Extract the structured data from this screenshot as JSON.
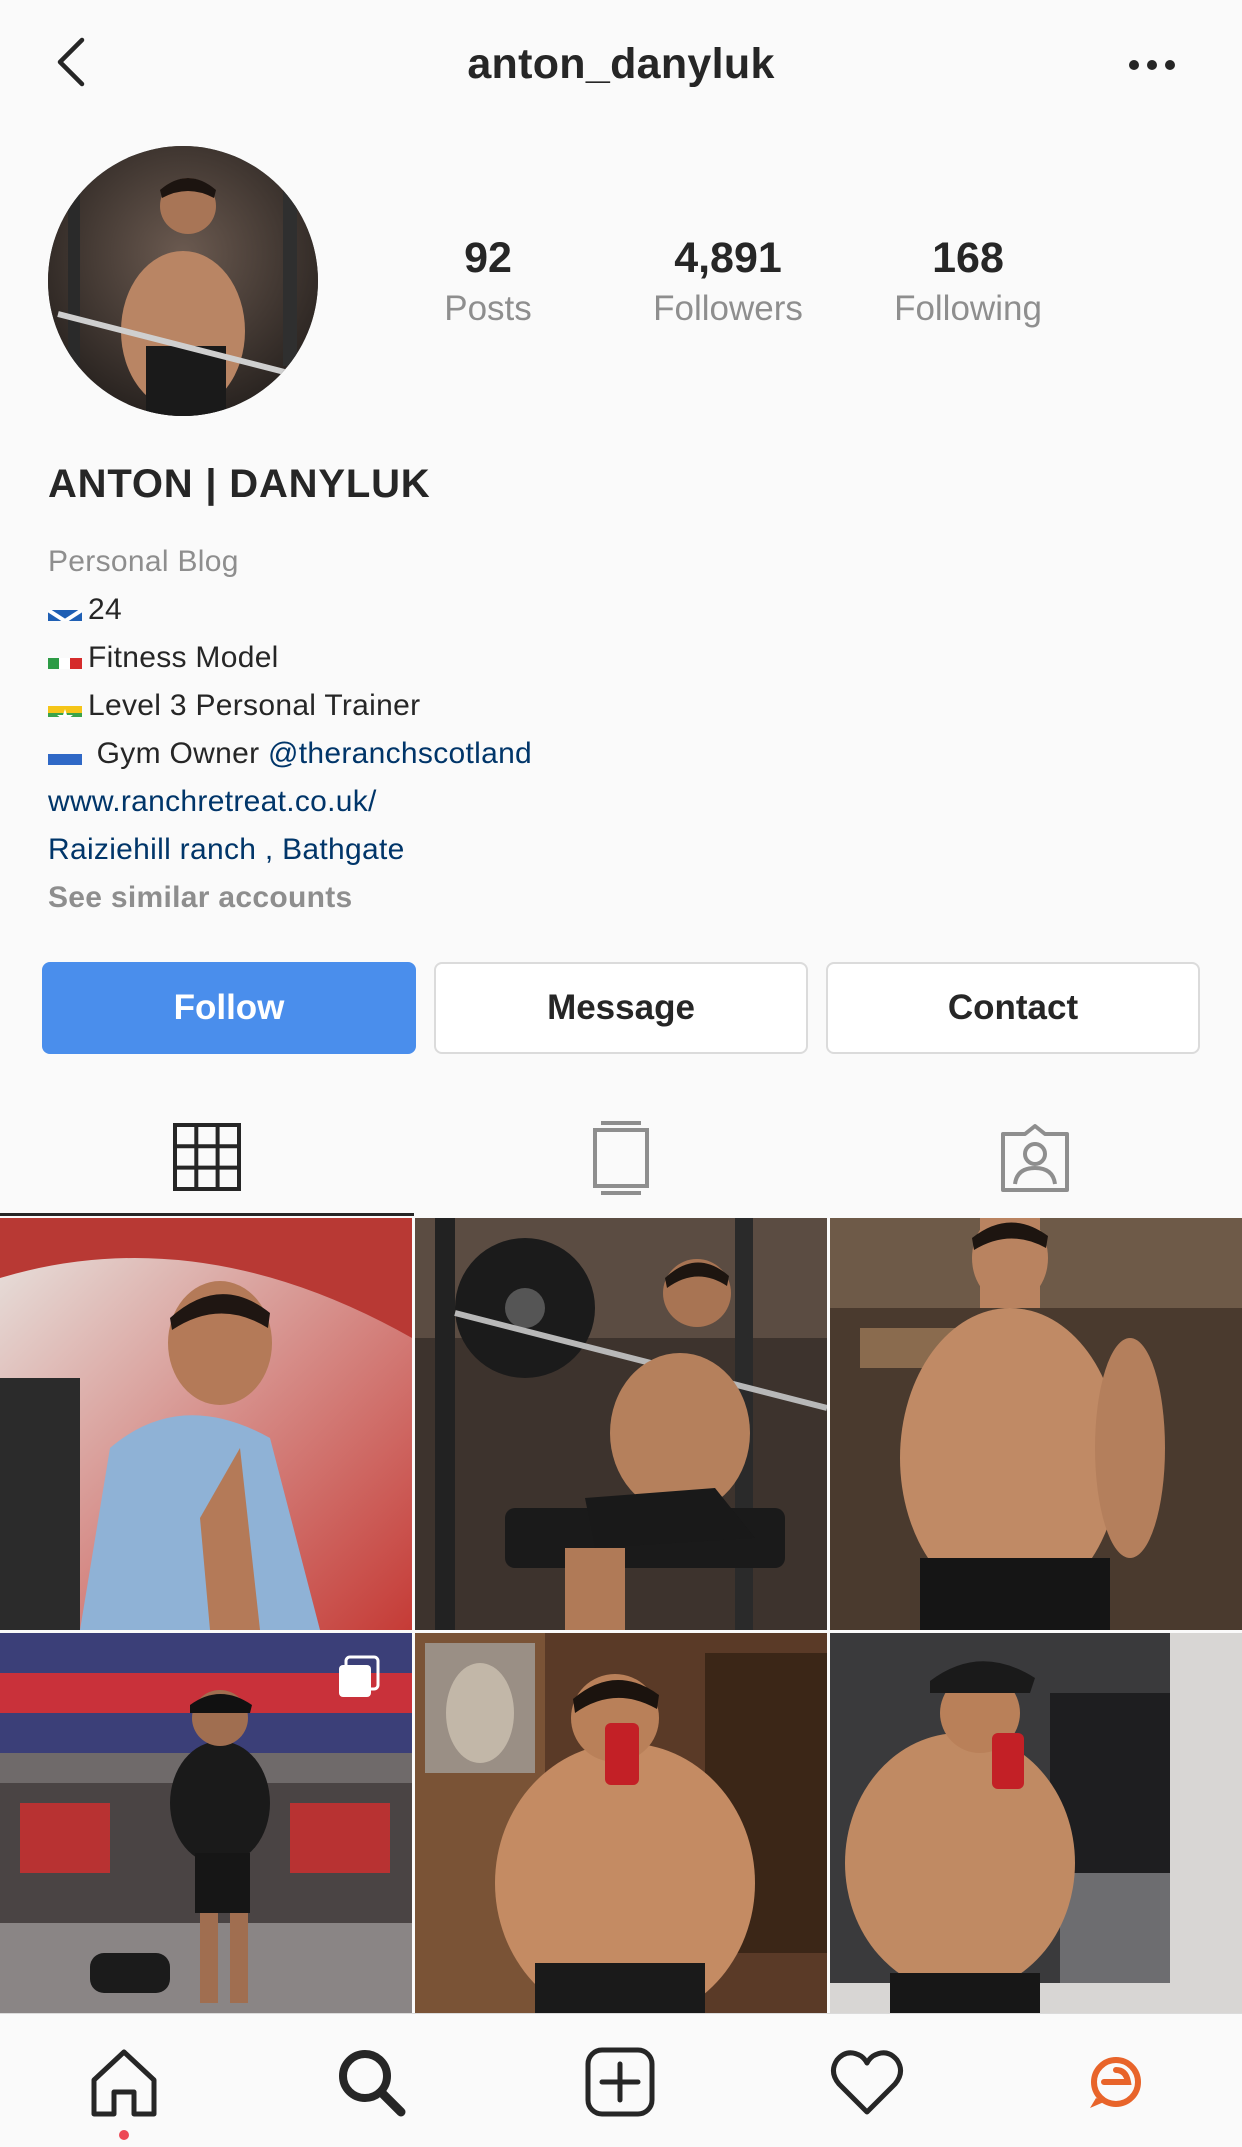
{
  "header": {
    "username": "anton_danyluk",
    "back_icon": "chevron-left-icon",
    "more_icon": "more-horizontal-icon"
  },
  "stats": {
    "posts_count": "92",
    "posts_label": "Posts",
    "followers_count": "4,891",
    "followers_label": "Followers",
    "following_count": "168",
    "following_label": "Following"
  },
  "profile": {
    "full_name": "ANTON | DANYLUK",
    "category": "Personal Blog",
    "bio_lines": [
      {
        "flag": "scotland-flag-icon",
        "text": "24"
      },
      {
        "flag": "italy-flag-icon",
        "text": "Fitness Model"
      },
      {
        "flag": "myanmar-flag-icon",
        "text": "Level 3 Personal Trainer"
      },
      {
        "flag": "ukraine-flag-icon",
        "text": " Gym Owner ",
        "mention": "@theranchscotland"
      }
    ],
    "website": "www.ranchretreat.co.uk/",
    "location": "Raiziehill ranch , Bathgate",
    "similar_accounts": "See similar accounts"
  },
  "actions": {
    "follow_label": "Follow",
    "message_label": "Message",
    "contact_label": "Contact"
  },
  "tabs": [
    {
      "icon": "grid-icon",
      "active": true
    },
    {
      "icon": "igtv-icon",
      "active": false
    },
    {
      "icon": "tagged-icon",
      "active": false
    }
  ],
  "posts": [
    {
      "subject": "man-in-denim-jacket-in-car"
    },
    {
      "subject": "man-on-bench-press"
    },
    {
      "subject": "shirtless-man-portrait"
    },
    {
      "subject": "gym-mirror-selfie",
      "badge": "multiple-photos-icon"
    },
    {
      "subject": "shirtless-mirror-selfie-bedroom"
    },
    {
      "subject": "shirtless-mirror-selfie-locker-room"
    }
  ],
  "bottom_nav": [
    {
      "icon": "home-icon",
      "active": true
    },
    {
      "icon": "search-icon"
    },
    {
      "icon": "new-post-icon"
    },
    {
      "icon": "activity-heart-icon"
    },
    {
      "icon": "profile-badge-icon"
    }
  ],
  "colors": {
    "follow_button": "#4a8eec",
    "link": "#003569",
    "muted_text": "#8e8e8e",
    "notification_dot": "#ed4956",
    "profile_badge": "#e8642a"
  }
}
